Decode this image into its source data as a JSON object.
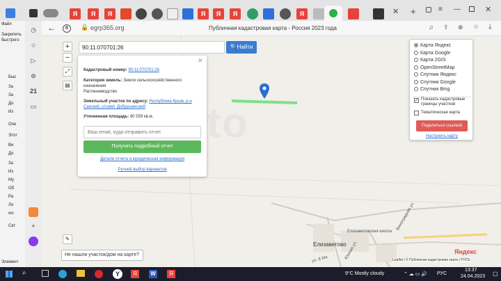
{
  "explorer": {
    "top_item": "Файл",
    "pin_hint": "Закрепить быстрого",
    "items": [
      "Быс",
      "За",
      "За",
      "До",
      "Из",
      "One",
      "Этот",
      "Ви",
      "До",
      "За",
      "Из",
      "Му",
      "Об",
      "Ра",
      "Ло",
      "wo",
      "Сет"
    ],
    "status": "Элемент"
  },
  "browser": {
    "url": "egrp365.org",
    "title": "Публичная кадастровая карта - Россия 2023 года",
    "tab_labels": [
      "Я",
      "Я",
      "Я",
      "Я",
      "Я",
      "Я",
      "Я"
    ]
  },
  "search": {
    "value": "90:11:070701:26",
    "button_label": "Найти"
  },
  "popup": {
    "cadastral_label": "Кадастровый номер:",
    "cadastral_value": "90:11:070701:26",
    "category_label": "Категория земель:",
    "category_value": "Земли сельскохозяйственного назначения",
    "usage": "Растениеводство",
    "address_label": "Земельный участок по адресу:",
    "address_value": "Республика Крым, р-н Сакский, с/совет Добрушинский",
    "area_label": "Уточненная площадь:",
    "area_value": "80 559 кв.м.",
    "email_placeholder": "Ваш email, куда отправить отчет",
    "report_button": "Получить подробный отчет",
    "details_link": "Детали отчета и юридическая информация",
    "manual_link": "Ручной выбор вариантов"
  },
  "layers": {
    "options": [
      "Карта Яндекс",
      "Карта Google",
      "Карта 2GIS",
      "OpenStreetMap",
      "Спутник Яндекс",
      "Спутник Google",
      "Спутник Bing"
    ],
    "selected": "Карта Яндекс",
    "show_parcels": "Показать кадастровые границы участков",
    "thematic": "Тематическая карта",
    "share_button": "Поделиться ссылкой",
    "configure_link": "Настроить карту"
  },
  "map_labels": {
    "watermark": "Avito",
    "village": "Елизаветово",
    "school": "Елизаветовская школа",
    "street1": "Виноградная ул.",
    "street2": "ул. 8 Ма",
    "street3": "Южная ул.",
    "attribution": "Leaflet | © Публичная кадастровая карта | РУСЕ",
    "yandex_logo": "Яндекс"
  },
  "not_found": "Не нашли участок/дом на карте?",
  "taskbar": {
    "weather": "9°C  Mostly cloudy",
    "lang": "РУС",
    "time": "13:37",
    "date": "24.04.2023"
  },
  "colors": {
    "search_button": "#3a7dd0",
    "report_button": "#5cb85c",
    "share_button": "#e05b55",
    "parcel_line": "#7ee08a",
    "marker": "#2a6fd0"
  }
}
